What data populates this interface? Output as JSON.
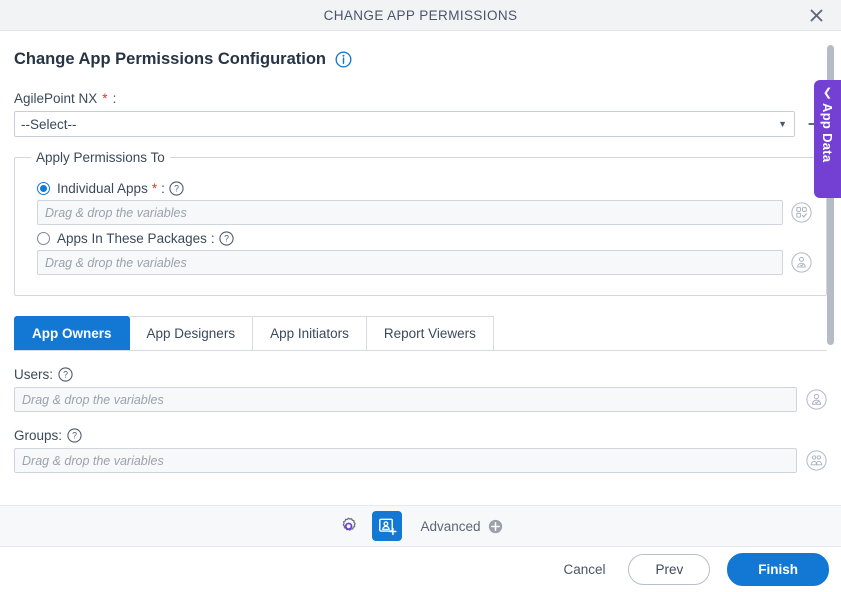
{
  "titlebar": {
    "title": "CHANGE APP PERMISSIONS",
    "close_icon": "close-icon"
  },
  "page": {
    "title": "Change App Permissions Configuration",
    "info_icon": "info-circle-icon"
  },
  "connection": {
    "label": "AgilePoint NX",
    "required_mark": "*",
    "label_colon": ":",
    "selected_value": "--Select--",
    "caret_icon": "chevron-down-icon",
    "add_icon": "plus-icon",
    "options": [
      "--Select--"
    ]
  },
  "apply_permissions": {
    "legend": "Apply Permissions To",
    "options": [
      {
        "label": "Individual Apps",
        "required_mark": "*",
        "label_colon": ":",
        "selected": true,
        "help_icon": "question-circle-icon",
        "input_placeholder": "Drag & drop the variables",
        "input_value": "",
        "picker_icon": "app-picker-icon"
      },
      {
        "label": "Apps In These Packages",
        "required_mark": "",
        "label_colon": ":",
        "selected": false,
        "help_icon": "question-circle-icon",
        "input_placeholder": "Drag & drop the variables",
        "input_value": "",
        "picker_icon": "package-picker-icon"
      }
    ]
  },
  "tabs": [
    {
      "label": "App Owners",
      "active": true
    },
    {
      "label": "App Designers",
      "active": false
    },
    {
      "label": "App Initiators",
      "active": false
    },
    {
      "label": "Report Viewers",
      "active": false
    }
  ],
  "tab_panel": {
    "fields": [
      {
        "label": "Users:",
        "help_icon": "question-circle-icon",
        "placeholder": "Drag & drop the variables",
        "value": "",
        "picker_icon": "user-picker-icon"
      },
      {
        "label": "Groups:",
        "help_icon": "question-circle-icon",
        "placeholder": "Drag & drop the variables",
        "value": "",
        "picker_icon": "group-picker-icon"
      }
    ]
  },
  "app_data_tab": {
    "label": "App Data",
    "chevron_icon": "chevron-left-icon"
  },
  "toolbar": {
    "gear_icon": "gear-icon",
    "permissions_icon": "user-add-icon",
    "advanced_label": "Advanced",
    "advanced_plus_icon": "plus-circle-icon"
  },
  "footer": {
    "cancel_label": "Cancel",
    "prev_label": "Prev",
    "finish_label": "Finish"
  },
  "colors": {
    "accent_blue": "#1278d4",
    "required_red": "#e2342a",
    "app_data_purple": "#7440d4",
    "gear_purple": "#6b3fd4",
    "titlebar_bg": "#f2f3f5",
    "toolbar_bg": "#f7f8fa",
    "input_bg": "#f7f8fa"
  },
  "scrollbar": {
    "orientation": "vertical",
    "thumb_ratio": 0.8
  }
}
